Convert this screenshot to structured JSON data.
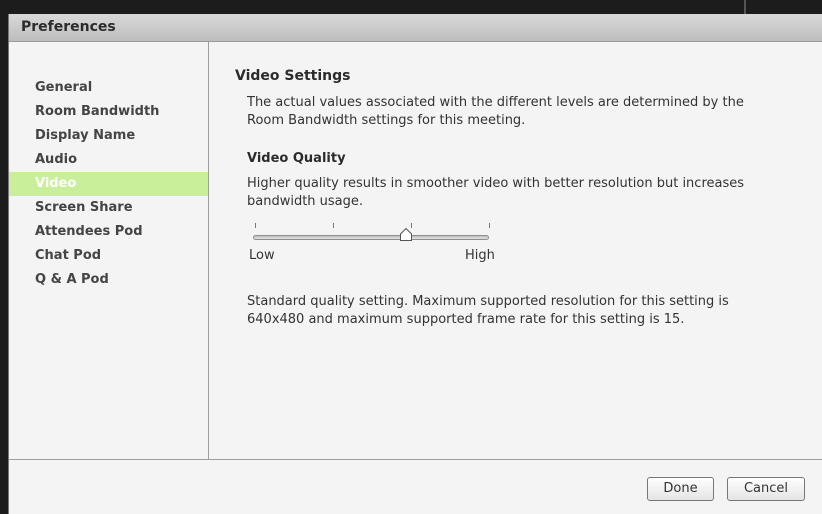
{
  "dialog": {
    "title": "Preferences"
  },
  "sidebar": {
    "items": [
      {
        "label": "General"
      },
      {
        "label": "Room Bandwidth"
      },
      {
        "label": "Display Name"
      },
      {
        "label": "Audio"
      },
      {
        "label": "Video",
        "selected": true
      },
      {
        "label": "Screen Share"
      },
      {
        "label": "Attendees Pod"
      },
      {
        "label": "Chat Pod"
      },
      {
        "label": "Q & A Pod"
      }
    ],
    "selected_color": "#c9ef9a"
  },
  "main": {
    "section_title": "Video Settings",
    "intro_line1": "The actual values associated with the different levels are determined by the",
    "intro_line2": "Room Bandwidth settings for this meeting.",
    "quality_title": "Video Quality",
    "quality_desc_line1": "Higher quality results in smoother video with better resolution but increases",
    "quality_desc_line2": "bandwidth usage.",
    "slider": {
      "min_label": "Low",
      "max_label": "High",
      "levels": 4,
      "value_fraction": 0.65
    },
    "status_line1": "Standard quality setting. Maximum supported resolution for this setting is",
    "status_line2": "640x480 and maximum supported frame rate for this setting is 15."
  },
  "footer": {
    "done_label": "Done",
    "cancel_label": "Cancel"
  }
}
